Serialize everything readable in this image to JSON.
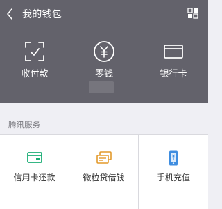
{
  "header": {
    "title": "我的钱包",
    "back_icon": "chevron-left-icon",
    "menu_icon": "grid-menu-icon",
    "background_color": "#63626b"
  },
  "features": [
    {
      "label": "收付款",
      "icon": "scan-check-icon"
    },
    {
      "label": "零钱",
      "icon": "yen-circle-icon"
    },
    {
      "label": "银行卡",
      "icon": "bank-card-icon"
    }
  ],
  "services": {
    "section_title": "腾讯服务",
    "items": [
      {
        "label": "信用卡还款",
        "icon": "credit-card-repay-icon",
        "color": "#1aad74"
      },
      {
        "label": "微粒贷借钱",
        "icon": "weilidai-loan-icon",
        "color": "#e39a2c"
      },
      {
        "label": "手机充值",
        "icon": "mobile-topup-icon",
        "color": "#3e8de0"
      }
    ]
  }
}
